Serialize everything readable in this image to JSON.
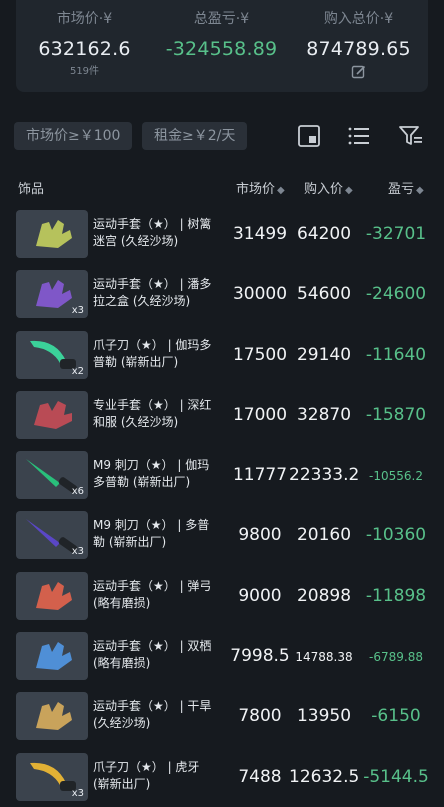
{
  "summary": {
    "market": {
      "label": "市场价·¥",
      "value": "632162.6",
      "sub": "519件"
    },
    "profit": {
      "label": "总盈亏·¥",
      "value": "-324558.89"
    },
    "purchase": {
      "label": "购入总价·¥",
      "value": "874789.65"
    }
  },
  "filters": {
    "market_filter": "市场价≥￥100",
    "rent_filter": "租金≥￥2/天"
  },
  "table": {
    "headers": {
      "item": "饰品",
      "market": "市场价",
      "buy": "购入价",
      "pl": "盈亏"
    },
    "rows": [
      {
        "name": "运动手套（★） | 树篱迷宫 (久经沙场)",
        "market": "31499",
        "buy": "64200",
        "pl": "-32701",
        "qty": "",
        "color": "#b6c25c"
      },
      {
        "name": "运动手套（★） | 潘多拉之盒 (久经沙场)",
        "market": "30000",
        "buy": "54600",
        "pl": "-24600",
        "qty": "x3",
        "color": "#7f57c8"
      },
      {
        "name": "爪子刀（★） | 伽玛多普勒 (崭新出厂)",
        "market": "17500",
        "buy": "29140",
        "pl": "-11640",
        "qty": "x2",
        "color": "#3bd29a"
      },
      {
        "name": "专业手套（★） | 深红和服 (久经沙场)",
        "market": "17000",
        "buy": "32870",
        "pl": "-15870",
        "qty": "",
        "color": "#b94b55"
      },
      {
        "name": "M9 刺刀（★） | 伽玛多普勒 (崭新出厂)",
        "market": "11777",
        "buy": "22333.2",
        "pl": "-10556.2",
        "qty": "x6",
        "color": "#29c07b"
      },
      {
        "name": "M9 刺刀（★） | 多普勒 (崭新出厂)",
        "market": "9800",
        "buy": "20160",
        "pl": "-10360",
        "qty": "x3",
        "color": "#5a47c6"
      },
      {
        "name": "运动手套（★） | 弹弓 (略有磨损)",
        "market": "9000",
        "buy": "20898",
        "pl": "-11898",
        "qty": "",
        "color": "#d3604c"
      },
      {
        "name": "运动手套（★） | 双栖 (略有磨损)",
        "market": "7998.5",
        "buy": "14788.38",
        "pl": "-6789.88",
        "qty": "",
        "color": "#4f8fd6"
      },
      {
        "name": "运动手套（★） | 干旱 (久经沙场)",
        "market": "7800",
        "buy": "13950",
        "pl": "-6150",
        "qty": "",
        "color": "#c9a35b"
      },
      {
        "name": "爪子刀（★） | 虎牙 (崭新出厂)",
        "market": "7488",
        "buy": "12632.5",
        "pl": "-5144.5",
        "qty": "x3",
        "color": "#e2b135"
      }
    ]
  },
  "icons": {
    "edit": "edit-icon",
    "view": "view-toggle-icon",
    "list": "list-icon",
    "filter": "filter-icon"
  },
  "colors": {
    "background": "#161a1f",
    "card": "#20262d",
    "loss": "#58c08a",
    "muted": "#7d8691"
  }
}
